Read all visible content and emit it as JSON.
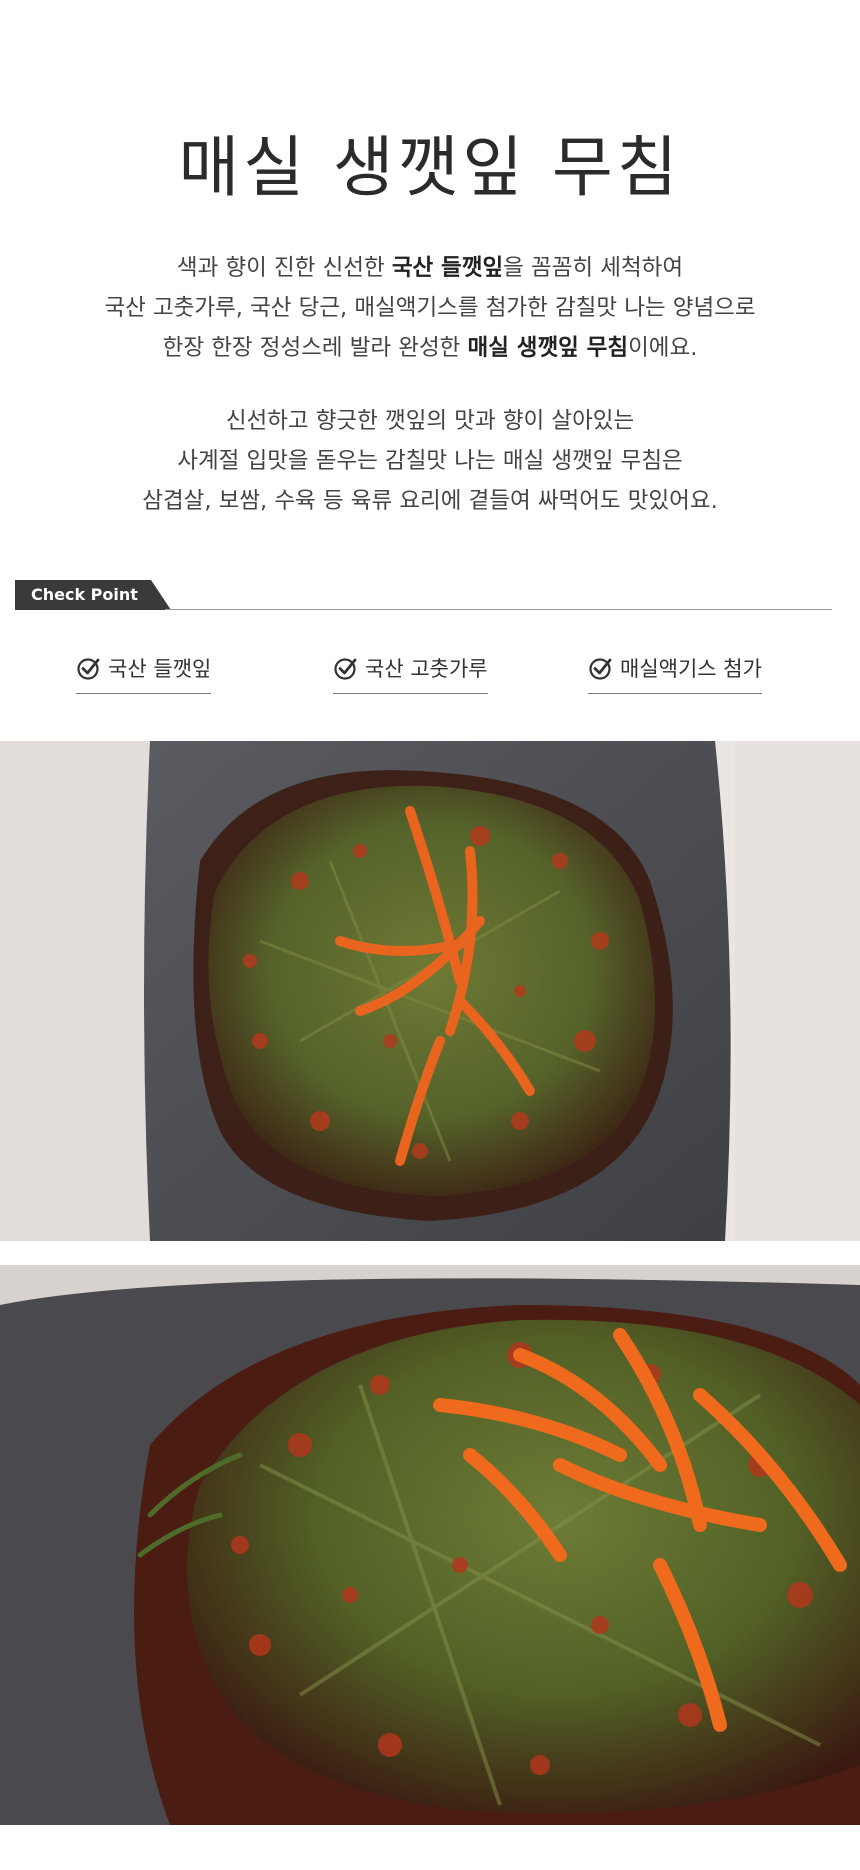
{
  "title": "매실 생깻잎 무침",
  "description1": [
    [
      {
        "t": "색과 향이 진한 신선한 "
      },
      {
        "t": "국산 들깻잎",
        "b": true
      },
      {
        "t": "을 꼼꼼히 세척하여"
      }
    ],
    [
      {
        "t": "국산 고춧가루, 국산 당근, 매실액기스를 첨가한 감칠맛 나는 양념으로"
      }
    ],
    [
      {
        "t": "한장 한장 정성스레 발라 완성한 "
      },
      {
        "t": "매실 생깻잎 무침",
        "b": true
      },
      {
        "t": "이에요."
      }
    ]
  ],
  "description2": [
    "신선하고 향긋한 깻잎의 맛과 향이 살아있는",
    "사계절 입맛을 돋우는 감칠맛 나는 매실 생깻잎 무침은",
    "삼겹살, 보쌈, 수육 등 육류 요리에 곁들여 싸먹어도 맛있어요."
  ],
  "check_point": {
    "label": "Check Point",
    "features": [
      "국산 들깻잎",
      "국산 고춧가루",
      "매실액기스 첨가"
    ],
    "icon": "check-circle-icon"
  },
  "photos": [
    {
      "subject": "perilla-leaf-kimchi-on-stone-plate-top-view",
      "colors": {
        "backdrop": "#e9e5e2",
        "plate": "#56575b",
        "leaf": "#5d6b2d",
        "sauce": "#b23a1c",
        "carrot": "#e8641f"
      }
    },
    {
      "subject": "perilla-leaf-kimchi-closeup",
      "colors": {
        "backdrop": "#d8d2cf",
        "plate": "#4a4a4e",
        "leaf": "#607030",
        "sauce": "#a8321a",
        "carrot": "#ef6a1c"
      }
    }
  ]
}
